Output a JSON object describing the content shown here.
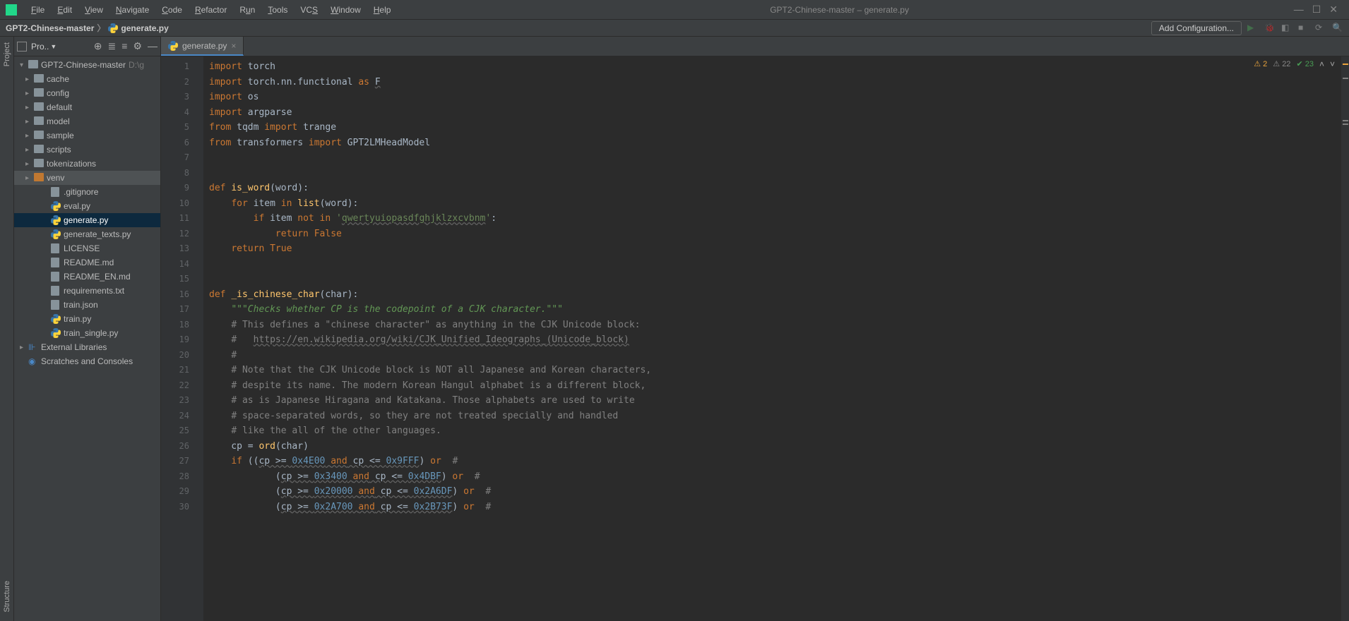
{
  "window": {
    "title": "GPT2-Chinese-master – generate.py"
  },
  "menu": {
    "items": [
      "File",
      "Edit",
      "View",
      "Navigate",
      "Code",
      "Refactor",
      "Run",
      "Tools",
      "VCS",
      "Window",
      "Help"
    ]
  },
  "breadcrumb": {
    "root": "GPT2-Chinese-master",
    "file": "generate.py"
  },
  "navbar": {
    "config_button": "Add Configuration..."
  },
  "project_panel": {
    "title": "Pro..",
    "tree": [
      {
        "label": "GPT2-Chinese-master",
        "depth": 0,
        "type": "folder",
        "expanded": true,
        "path": "D:\\g"
      },
      {
        "label": "cache",
        "depth": 1,
        "type": "folder",
        "expanded": false
      },
      {
        "label": "config",
        "depth": 1,
        "type": "folder",
        "expanded": false
      },
      {
        "label": "default",
        "depth": 1,
        "type": "folder",
        "expanded": false
      },
      {
        "label": "model",
        "depth": 1,
        "type": "folder",
        "expanded": false
      },
      {
        "label": "sample",
        "depth": 1,
        "type": "folder",
        "expanded": false
      },
      {
        "label": "scripts",
        "depth": 1,
        "type": "folder",
        "expanded": false
      },
      {
        "label": "tokenizations",
        "depth": 1,
        "type": "folder",
        "expanded": false
      },
      {
        "label": "venv",
        "depth": 1,
        "type": "folder-orange",
        "expanded": false,
        "highlighted": true
      },
      {
        "label": ".gitignore",
        "depth": 2,
        "type": "file"
      },
      {
        "label": "eval.py",
        "depth": 2,
        "type": "py"
      },
      {
        "label": "generate.py",
        "depth": 2,
        "type": "py",
        "selected": true
      },
      {
        "label": "generate_texts.py",
        "depth": 2,
        "type": "py"
      },
      {
        "label": "LICENSE",
        "depth": 2,
        "type": "file"
      },
      {
        "label": "README.md",
        "depth": 2,
        "type": "md"
      },
      {
        "label": "README_EN.md",
        "depth": 2,
        "type": "md"
      },
      {
        "label": "requirements.txt",
        "depth": 2,
        "type": "file"
      },
      {
        "label": "train.json",
        "depth": 2,
        "type": "json"
      },
      {
        "label": "train.py",
        "depth": 2,
        "type": "py"
      },
      {
        "label": "train_single.py",
        "depth": 2,
        "type": "py"
      },
      {
        "label": "External Libraries",
        "depth": 0,
        "type": "lib",
        "expanded": false
      },
      {
        "label": "Scratches and Consoles",
        "depth": 0,
        "type": "scratch"
      }
    ]
  },
  "tabs": {
    "open": [
      {
        "label": "generate.py"
      }
    ]
  },
  "editor": {
    "line_start": 1,
    "line_end": 30,
    "indicators": {
      "warn": "2",
      "weak": "22",
      "ok": "23"
    },
    "lines": [
      {
        "n": 1,
        "html": "<span class='kw'>import</span> torch"
      },
      {
        "n": 2,
        "html": "<span class='kw'>import</span> torch.nn.functional <span class='kw'>as</span> <span class='underl'>F</span>"
      },
      {
        "n": 3,
        "html": "<span class='kw'>import</span> os"
      },
      {
        "n": 4,
        "html": "<span class='kw'>import</span> argparse"
      },
      {
        "n": 5,
        "html": "<span class='kw'>from</span> tqdm <span class='kw'>import</span> trange"
      },
      {
        "n": 6,
        "html": "<span class='kw'>from</span> transformers <span class='kw'>import</span> GPT2LMHeadModel"
      },
      {
        "n": 7,
        "html": ""
      },
      {
        "n": 8,
        "html": ""
      },
      {
        "n": 9,
        "html": "<span class='kw'>def</span> <span class='def'>is_word</span>(word):"
      },
      {
        "n": 10,
        "html": "    <span class='kw'>for</span> item <span class='kw'>in</span> <span class='def'>list</span>(word):"
      },
      {
        "n": 11,
        "html": "        <span class='kw'>if</span> item <span class='kw'>not in</span> <span class='str'>'<span class='underl'>qwertyuiopasdfghjklzxcvbnm</span>'</span>:"
      },
      {
        "n": 12,
        "html": "            <span class='kw'>return</span> <span class='kw'>False</span>"
      },
      {
        "n": 13,
        "html": "    <span class='kw'>return</span> <span class='kw'>True</span>"
      },
      {
        "n": 14,
        "html": ""
      },
      {
        "n": 15,
        "html": ""
      },
      {
        "n": 16,
        "html": "<span class='kw'>def</span> <span class='def'>_is_chinese_char</span>(char):"
      },
      {
        "n": 17,
        "html": "    <span class='doc'>\"\"\"Checks whether CP is the codepoint of a CJK character.\"\"\"</span>"
      },
      {
        "n": 18,
        "html": "    <span class='com'># This defines a \"chinese character\" as anything in the CJK Unicode block:</span>"
      },
      {
        "n": 19,
        "html": "    <span class='com'>#   <span class='link'>https://en.wikipedia.org/wiki/CJK_Unified_Ideographs_(Unicode_block)</span></span>"
      },
      {
        "n": 20,
        "html": "    <span class='com'>#</span>"
      },
      {
        "n": 21,
        "html": "    <span class='com'># Note that the CJK Unicode block is NOT all Japanese and Korean characters,</span>"
      },
      {
        "n": 22,
        "html": "    <span class='com'># despite its name. The modern Korean Hangul alphabet is a different block,</span>"
      },
      {
        "n": 23,
        "html": "    <span class='com'># as is Japanese Hiragana and Katakana. Those alphabets are used to write</span>"
      },
      {
        "n": 24,
        "html": "    <span class='com'># space-separated words, so they are not treated specially and handled</span>"
      },
      {
        "n": 25,
        "html": "    <span class='com'># like the all of the other languages.</span>"
      },
      {
        "n": 26,
        "html": "    cp = <span class='def'>ord</span>(char)"
      },
      {
        "n": 27,
        "html": "    <span class='kw'>if</span> ((<span class='underl'>cp &gt;= <span class='num'>0x4E00</span> <span class='kw'>and</span> cp &lt;= <span class='num'>0x9FFF</span></span>) <span class='kw'>or</span>  <span class='com'>#</span>"
      },
      {
        "n": 28,
        "html": "            (<span class='underl'>cp &gt;= <span class='num'>0x3400</span> <span class='kw'>and</span> cp &lt;= <span class='num'>0x4DBF</span></span>) <span class='kw'>or</span>  <span class='com'>#</span>"
      },
      {
        "n": 29,
        "html": "            (<span class='underl'>cp &gt;= <span class='num'>0x20000</span> <span class='kw'>and</span> cp &lt;= <span class='num'>0x2A6DF</span></span>) <span class='kw'>or</span>  <span class='com'>#</span>"
      },
      {
        "n": 30,
        "html": "            (<span class='underl'>cp &gt;= <span class='num'>0x2A700</span> <span class='kw'>and</span> cp &lt;= <span class='num'>0x2B73F</span></span>) <span class='kw'>or</span>  <span class='com'>#</span>"
      }
    ]
  },
  "sidebar_labels": {
    "project": "Project",
    "structure": "Structure"
  }
}
